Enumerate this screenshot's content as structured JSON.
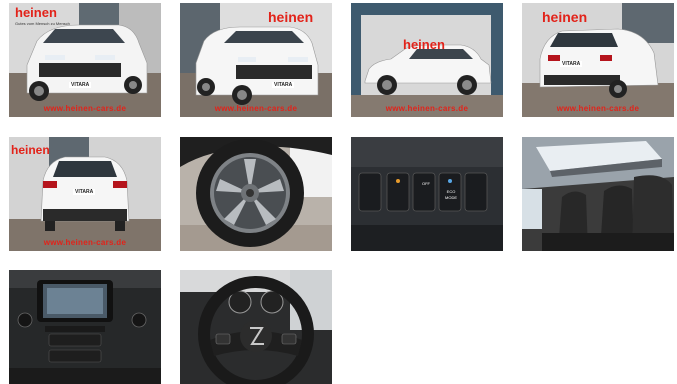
{
  "gallery": {
    "dealer_logo": "heinen",
    "dealer_tagline": "Gutes vom Mensch zu Mensch",
    "watermark": "www.heinen-cars.de",
    "model_badge": "VITARA",
    "console_buttons": [
      "OFF",
      "ECO",
      "MODE"
    ],
    "thumbnails": [
      {
        "name": "photo-front-left"
      },
      {
        "name": "photo-front-right"
      },
      {
        "name": "photo-side"
      },
      {
        "name": "photo-rear-right"
      },
      {
        "name": "photo-rear"
      },
      {
        "name": "photo-wheel"
      },
      {
        "name": "photo-console-buttons"
      },
      {
        "name": "photo-interior-sunroof"
      },
      {
        "name": "photo-dashboard-center"
      },
      {
        "name": "photo-steering-wheel"
      }
    ]
  }
}
